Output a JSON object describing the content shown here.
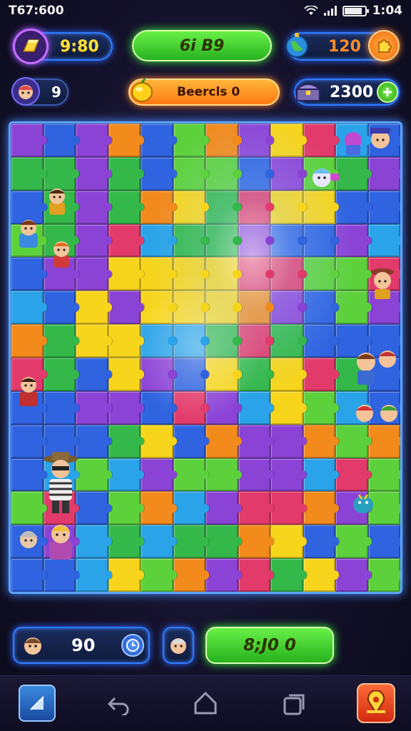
{
  "status_bar": {
    "time": "T67:600",
    "clock": "1:04"
  },
  "top_row": {
    "gold_value": "9:80",
    "center_value": "6i B9",
    "resource_value": "120"
  },
  "second_row": {
    "lives_value": "9",
    "search_label": "Beercls 0",
    "coins_value": "2300"
  },
  "bottom_hud": {
    "moves_value": "90",
    "action_value": "8;J0 0"
  },
  "colors": {
    "puzzle_palette": [
      "#2f63e0",
      "#34b84a",
      "#f7d51c",
      "#8b43d6",
      "#f28a1c",
      "#2aa3e8",
      "#e23a6a",
      "#5dd13c"
    ],
    "accent_blue": "#2f7bff",
    "accent_green": "#3df03a",
    "accent_orange": "#ff8c2a"
  },
  "icons": {
    "top_left": "gold-bar-icon",
    "top_right": "globe-icon",
    "top_right_action": "puzzle-piece-icon",
    "lives": "character-face-icon",
    "search": "lemon-icon",
    "coins": "treasure-icon",
    "add": "plus-icon",
    "moves": "character-face-icon",
    "timer": "clock-icon",
    "hint": "character-face-icon",
    "nav_left": "app-icon",
    "nav_back": "back-arrow-icon",
    "nav_home": "home-icon",
    "nav_recents": "recents-icon",
    "nav_right": "map-pin-icon"
  }
}
